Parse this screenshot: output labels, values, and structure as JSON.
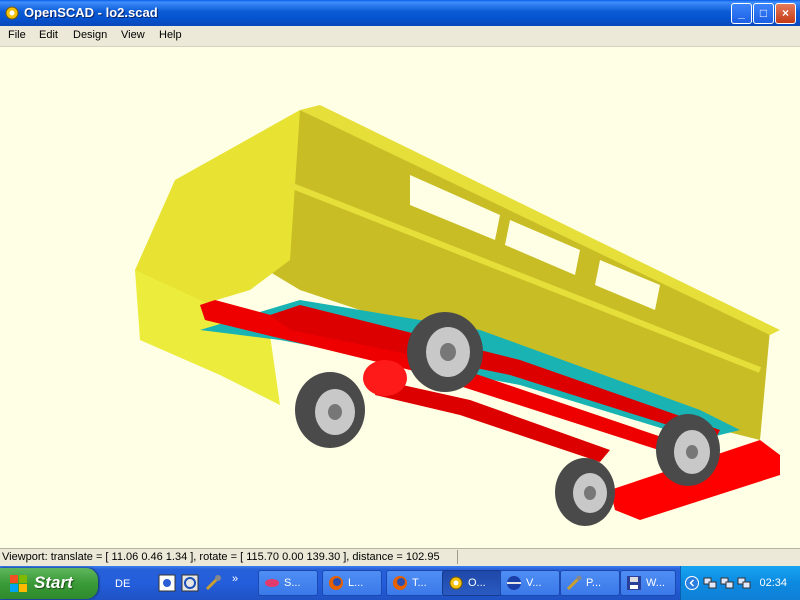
{
  "window": {
    "title": "OpenSCAD - lo2.scad",
    "buttons": {
      "minimize": "_",
      "maximize": "□",
      "close": "×"
    }
  },
  "menubar": {
    "items": [
      "File",
      "Edit",
      "Design",
      "View",
      "Help"
    ]
  },
  "viewport": {
    "background": "#ffffe5",
    "colors": {
      "body": "#e8e232",
      "body_shade": "#c8bd28",
      "chassis": "#ff0000",
      "floor": "#19b3b3",
      "tire": "#5a5a5a"
    }
  },
  "statusbar": {
    "text": "Viewport: translate = [ 11.06 0.46 1.34 ], rotate = [ 115.70 0.00 139.30 ], distance = 102.95"
  },
  "taskbar": {
    "start_label": "Start",
    "language": "DE",
    "chevron": "»",
    "tasks": [
      {
        "label": "S...",
        "icon": "lips-icon"
      },
      {
        "label": "L...",
        "icon": "firefox-icon"
      },
      {
        "label": "T...",
        "icon": "firefox-icon"
      },
      {
        "label": "O...",
        "icon": "openscad-icon",
        "active": true
      },
      {
        "label": "V...",
        "icon": "globe-icon"
      },
      {
        "label": "P...",
        "icon": "tools-icon"
      },
      {
        "label": "W...",
        "icon": "floppy-icon"
      }
    ],
    "clock": "02:34"
  }
}
